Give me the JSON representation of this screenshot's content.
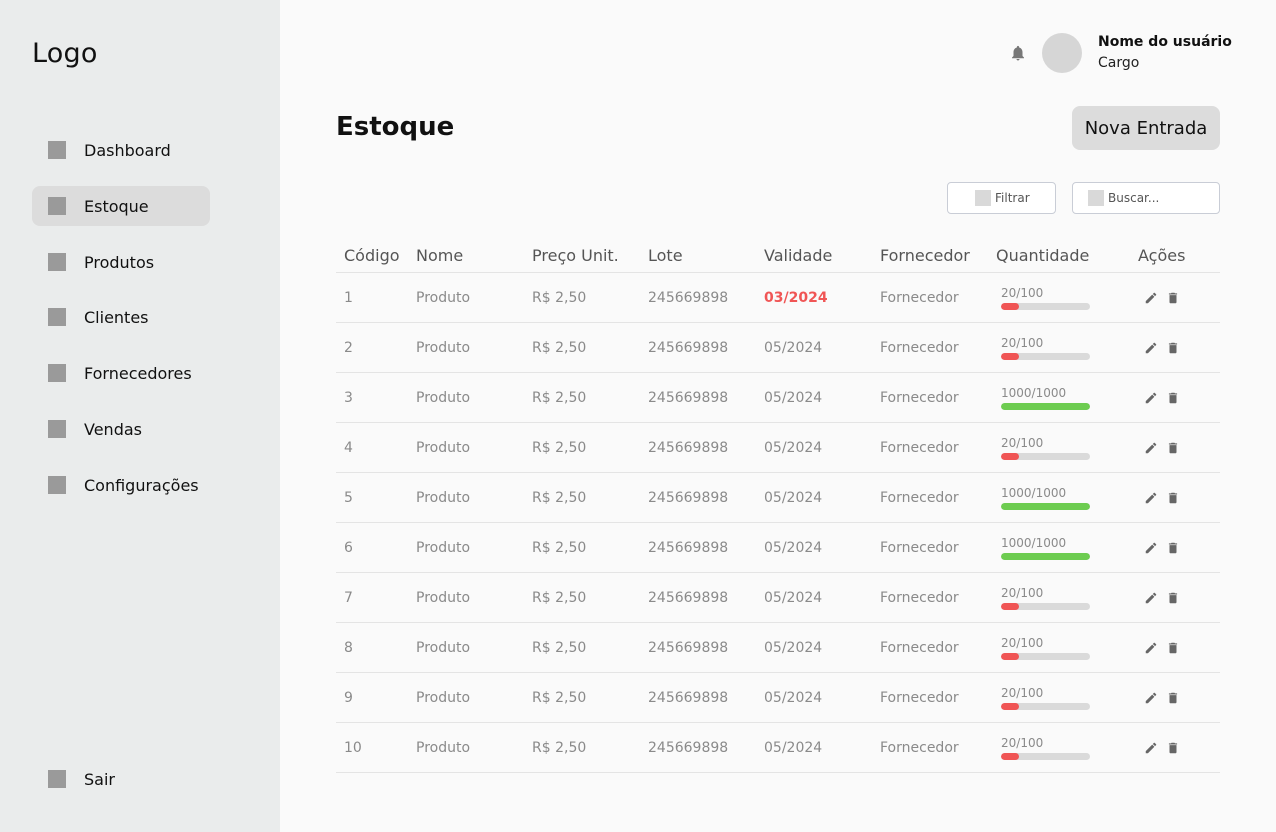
{
  "sidebar": {
    "logo": "Logo",
    "items": [
      {
        "label": "Dashboard",
        "active": false
      },
      {
        "label": "Estoque",
        "active": true
      },
      {
        "label": "Produtos",
        "active": false
      },
      {
        "label": "Clientes",
        "active": false
      },
      {
        "label": "Fornecedores",
        "active": false
      },
      {
        "label": "Vendas",
        "active": false
      },
      {
        "label": "Configurações",
        "active": false
      }
    ],
    "logout": "Sair"
  },
  "header": {
    "user_name": "Nome do usuário",
    "user_role": "Cargo",
    "bell_icon": "bell-icon"
  },
  "page": {
    "title": "Estoque",
    "new_entry_label": "Nova Entrada",
    "filter_label": "Filtrar",
    "search_placeholder": "Buscar..."
  },
  "table": {
    "columns": [
      "Código",
      "Nome",
      "Preço Unit.",
      "Lote",
      "Validade",
      "Fornecedor",
      "Quantidade",
      "Ações"
    ],
    "rows": [
      {
        "code": "1",
        "name": "Produto",
        "price": "R$ 2,50",
        "lot": "245669898",
        "expiry": "03/2024",
        "expired": true,
        "supplier": "Fornecedor",
        "qty_text": "20/100",
        "qty_fraction": 0.2
      },
      {
        "code": "2",
        "name": "Produto",
        "price": "R$ 2,50",
        "lot": "245669898",
        "expiry": "05/2024",
        "expired": false,
        "supplier": "Fornecedor",
        "qty_text": "20/100",
        "qty_fraction": 0.2
      },
      {
        "code": "3",
        "name": "Produto",
        "price": "R$ 2,50",
        "lot": "245669898",
        "expiry": "05/2024",
        "expired": false,
        "supplier": "Fornecedor",
        "qty_text": "1000/1000",
        "qty_fraction": 1.0
      },
      {
        "code": "4",
        "name": "Produto",
        "price": "R$ 2,50",
        "lot": "245669898",
        "expiry": "05/2024",
        "expired": false,
        "supplier": "Fornecedor",
        "qty_text": "20/100",
        "qty_fraction": 0.2
      },
      {
        "code": "5",
        "name": "Produto",
        "price": "R$ 2,50",
        "lot": "245669898",
        "expiry": "05/2024",
        "expired": false,
        "supplier": "Fornecedor",
        "qty_text": "1000/1000",
        "qty_fraction": 1.0
      },
      {
        "code": "6",
        "name": "Produto",
        "price": "R$ 2,50",
        "lot": "245669898",
        "expiry": "05/2024",
        "expired": false,
        "supplier": "Fornecedor",
        "qty_text": "1000/1000",
        "qty_fraction": 1.0
      },
      {
        "code": "7",
        "name": "Produto",
        "price": "R$ 2,50",
        "lot": "245669898",
        "expiry": "05/2024",
        "expired": false,
        "supplier": "Fornecedor",
        "qty_text": "20/100",
        "qty_fraction": 0.2
      },
      {
        "code": "8",
        "name": "Produto",
        "price": "R$ 2,50",
        "lot": "245669898",
        "expiry": "05/2024",
        "expired": false,
        "supplier": "Fornecedor",
        "qty_text": "20/100",
        "qty_fraction": 0.2
      },
      {
        "code": "9",
        "name": "Produto",
        "price": "R$ 2,50",
        "lot": "245669898",
        "expiry": "05/2024",
        "expired": false,
        "supplier": "Fornecedor",
        "qty_text": "20/100",
        "qty_fraction": 0.2
      },
      {
        "code": "10",
        "name": "Produto",
        "price": "R$ 2,50",
        "lot": "245669898",
        "expiry": "05/2024",
        "expired": false,
        "supplier": "Fornecedor",
        "qty_text": "20/100",
        "qty_fraction": 0.2
      }
    ]
  },
  "colors": {
    "low_stock": "#f05555",
    "full_stock": "#6dcc50",
    "expired_text": "#f05555",
    "sidebar_bg": "#eaecec",
    "page_bg": "#fafafa"
  },
  "icons": {
    "edit": "pencil-icon",
    "delete": "trash-icon",
    "nav": "square-placeholder-icon"
  }
}
